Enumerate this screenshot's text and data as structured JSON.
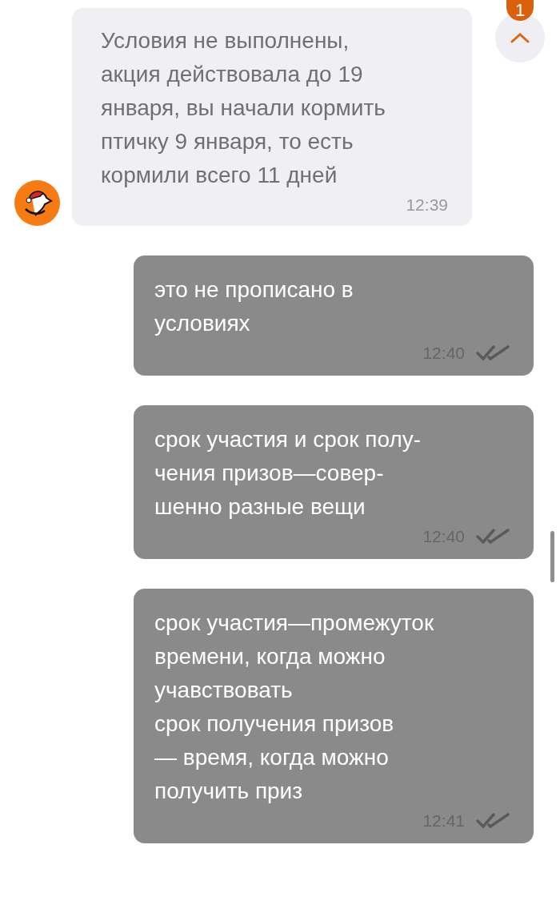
{
  "scroll_button": {
    "badge": "1"
  },
  "messages": [
    {
      "kind": "incoming",
      "text": "Условия не выполнены,\nакция действовала до 19\nянваря, вы начали кормить\nптичку 9 января, то есть\nкормили всего 11 дней",
      "time": "12:39"
    },
    {
      "kind": "outgoing",
      "text": "это не прописано в\nусловиях",
      "time": "12:40",
      "read": true
    },
    {
      "kind": "outgoing",
      "text": "срок участия и срок полу-\nчения призов—совер-\nшенно разные вещи",
      "time": "12:40",
      "read": true
    },
    {
      "kind": "outgoing",
      "text": "срок участия—промежуток\nвремени, когда можно\nучавствовать\nсрок получения призов\n— время, когда можно\nполучить приз",
      "time": "12:41",
      "read": true
    }
  ]
}
